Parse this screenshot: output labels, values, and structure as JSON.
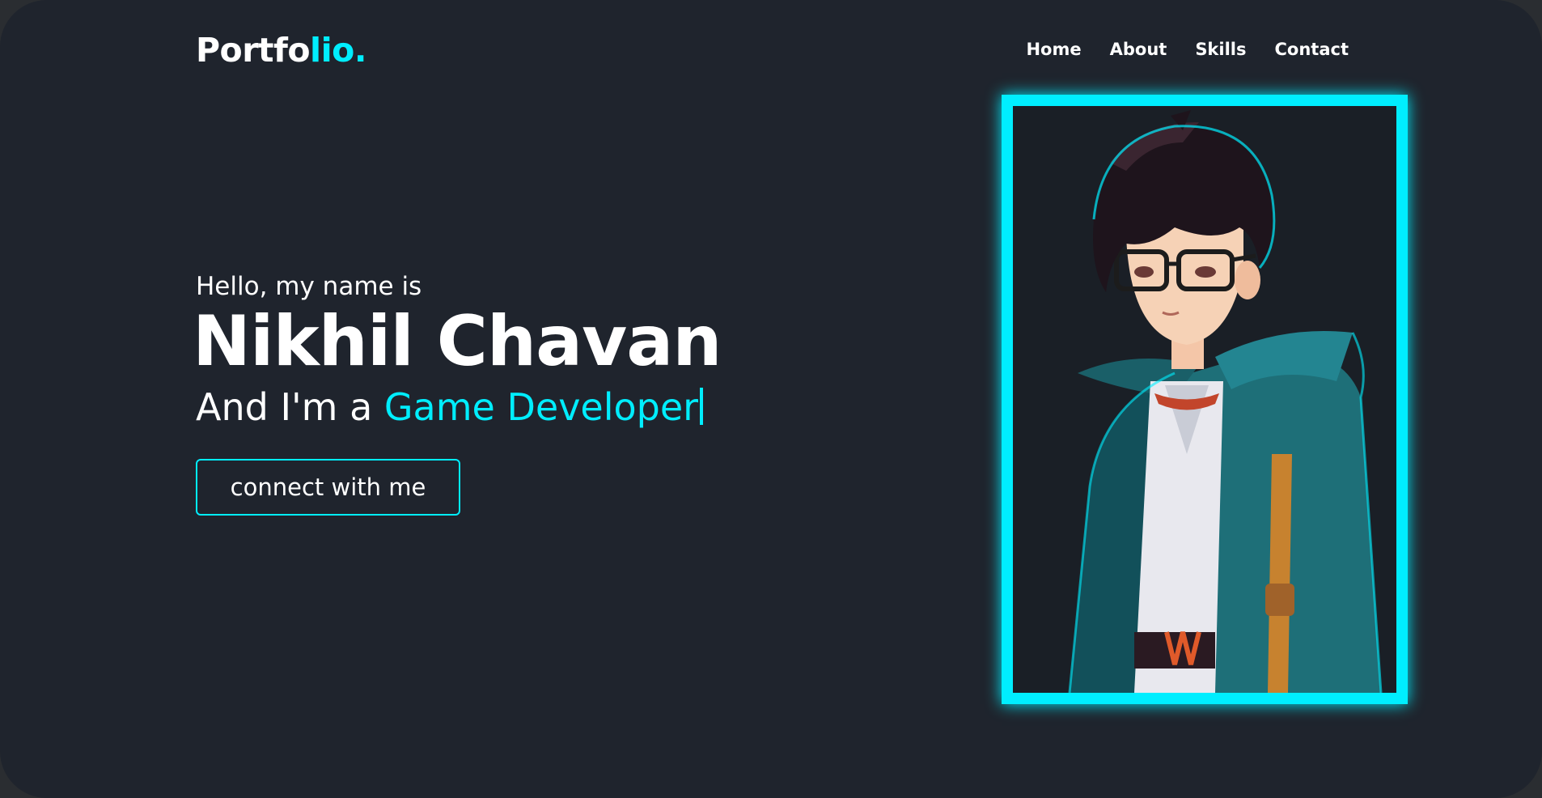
{
  "header": {
    "logo_main": "Portfo",
    "logo_accent": "lio.",
    "nav": [
      "Home",
      "About",
      "Skills",
      "Contact"
    ]
  },
  "hero": {
    "greeting": "Hello, my name is",
    "name": "Nikhil Chavan",
    "role_prefix": "And I'm a",
    "role_typed": "Game Developer",
    "cta_label": "connect with me"
  },
  "colors": {
    "background": "#1f242d",
    "accent": "#00eeff",
    "text": "#ffffff"
  },
  "image": {
    "subject": "anime-style boy with glasses and teal hooded jacket"
  }
}
